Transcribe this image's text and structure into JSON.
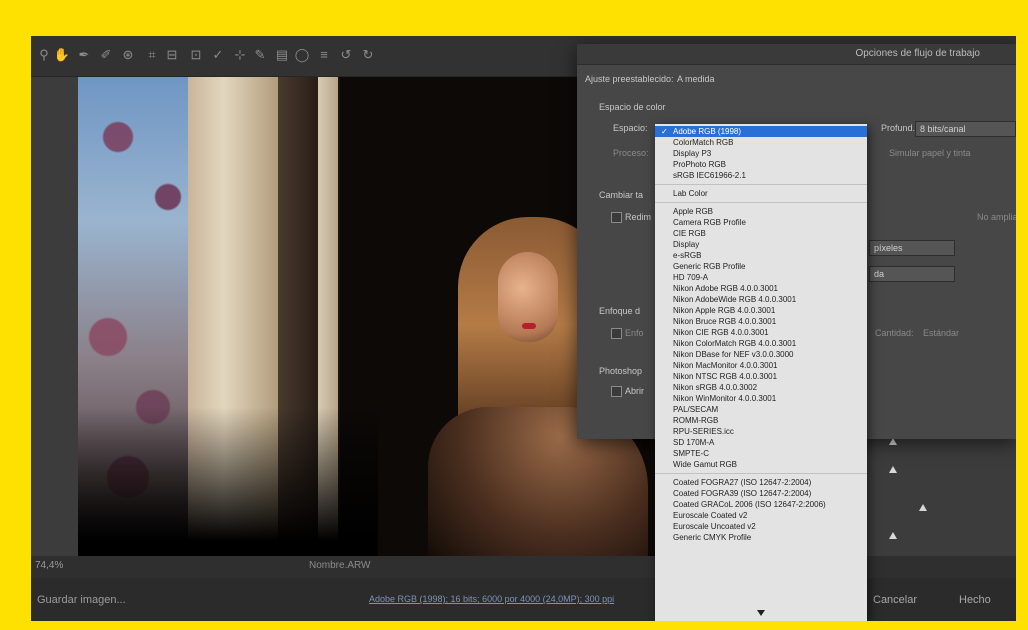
{
  "toolbar": {
    "tools": [
      {
        "icon": "zoom-icon",
        "glyph": "⚲"
      },
      {
        "icon": "hand-icon",
        "glyph": "✋"
      },
      {
        "icon": "eyedropper-icon",
        "glyph": "✒"
      },
      {
        "icon": "color-sampler-icon",
        "glyph": "✐"
      },
      {
        "icon": "target-adjust-icon",
        "glyph": "⊛"
      },
      {
        "icon": "crop-icon",
        "glyph": "⌗"
      },
      {
        "icon": "straighten-icon",
        "glyph": "⊟"
      },
      {
        "icon": "transform-icon",
        "glyph": "⊡"
      },
      {
        "icon": "spot-removal-icon",
        "glyph": "✓"
      },
      {
        "icon": "red-eye-icon",
        "glyph": "⊹"
      },
      {
        "icon": "adjustment-brush-icon",
        "glyph": "✎"
      },
      {
        "icon": "graduated-filter-icon",
        "glyph": "▤"
      },
      {
        "icon": "radial-filter-icon",
        "glyph": "◯"
      },
      {
        "icon": "preferences-icon",
        "glyph": "≡"
      },
      {
        "icon": "rotate-left-icon",
        "glyph": "↺"
      },
      {
        "icon": "rotate-right-icon",
        "glyph": "↻"
      }
    ]
  },
  "status": {
    "zoom": "74,4%",
    "center_label": "Nombre.ARW"
  },
  "footer": {
    "save_label": "Guardar imagen...",
    "workflow_link": "Adobe RGB (1998); 16 bits; 6000 por 4000 (24,0MP); 300 ppi",
    "cancel_label": "Cancelar",
    "done_label": "Hecho"
  },
  "dialog": {
    "title": "Opciones de flujo de trabajo",
    "preset_label": "Ajuste preestablecido:",
    "preset_value": "A medida",
    "color_space_section": "Espacio de color",
    "space_label": "Espacio:",
    "depth_label": "Profund.:",
    "depth_value": "8 bits/canal",
    "proof_label": "Proceso:",
    "simulate_label": "Simular papel y tinta",
    "resize_section": "Cambiar ta",
    "resize_checkbox": "Redim",
    "no_enlarge": "No ampliar",
    "pixels_value": "píxeles",
    "resolution_value": "da",
    "sharpen_section": "Enfoque d",
    "sharpen_checkbox": "Enfo",
    "sharpen_amount_label": "Cantidad:",
    "sharpen_amount_value": "Estándar",
    "photoshop_section": "Photoshop",
    "photoshop_checkbox": "Abrir"
  },
  "dropdown": {
    "selected": "Adobe RGB (1998)",
    "groups": [
      [
        "Adobe RGB (1998)",
        "ColorMatch RGB",
        "Display P3",
        "ProPhoto RGB",
        "sRGB IEC61966-2.1"
      ],
      [
        "Lab Color"
      ],
      [
        "Apple RGB",
        "Camera RGB Profile",
        "CIE RGB",
        "Display",
        "e-sRGB",
        "Generic RGB Profile",
        "HD 709-A",
        "Nikon Adobe RGB 4.0.0.3001",
        "Nikon AdobeWide RGB 4.0.0.3001",
        "Nikon Apple RGB 4.0.0.3001",
        "Nikon Bruce RGB 4.0.0.3001",
        "Nikon CIE RGB 4.0.0.3001",
        "Nikon ColorMatch RGB 4.0.0.3001",
        "Nikon DBase for NEF v3.0.0.3000",
        "Nikon MacMonitor 4.0.0.3001",
        "Nikon NTSC RGB 4.0.0.3001",
        "Nikon sRGB 4.0.0.3002",
        "Nikon WinMonitor 4.0.0.3001",
        "PAL/SECAM",
        "ROMM-RGB",
        "RPU-SERIES.icc",
        "SD 170M-A",
        "SMPTE-C",
        "Wide Gamut RGB"
      ],
      [
        "Coated FOGRA27 (ISO 12647-2:2004)",
        "Coated FOGRA39 (ISO 12647-2:2004)",
        "Coated GRACoL 2006 (ISO 12647-2:2006)",
        "Euroscale Coated v2",
        "Euroscale Uncoated v2",
        "Generic CMYK Profile"
      ]
    ]
  },
  "colors": {
    "selection": "#2a6fd6",
    "frame": "#ffe100"
  }
}
